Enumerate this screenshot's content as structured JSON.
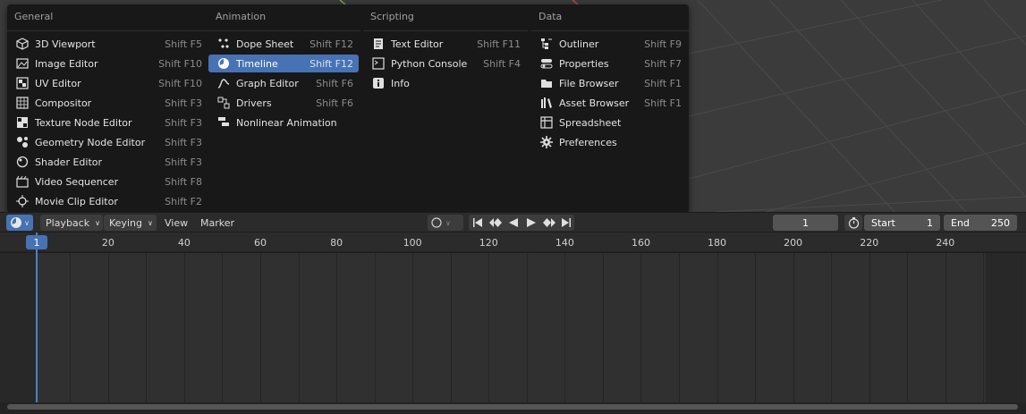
{
  "menu": {
    "columns": [
      {
        "header": "General",
        "items": [
          {
            "icon": "3d-viewport-icon",
            "label": "3D Viewport",
            "shortcut": "Shift F5"
          },
          {
            "icon": "image-editor-icon",
            "label": "Image Editor",
            "shortcut": "Shift F10"
          },
          {
            "icon": "uv-editor-icon",
            "label": "UV Editor",
            "shortcut": "Shift F10"
          },
          {
            "icon": "compositor-icon",
            "label": "Compositor",
            "shortcut": "Shift F3"
          },
          {
            "icon": "texture-node-editor-icon",
            "label": "Texture Node Editor",
            "shortcut": "Shift F3"
          },
          {
            "icon": "geometry-node-editor-icon",
            "label": "Geometry Node Editor",
            "shortcut": "Shift F3"
          },
          {
            "icon": "shader-editor-icon",
            "label": "Shader Editor",
            "shortcut": "Shift F3"
          },
          {
            "icon": "video-sequencer-icon",
            "label": "Video Sequencer",
            "shortcut": "Shift F8"
          },
          {
            "icon": "movie-clip-editor-icon",
            "label": "Movie Clip Editor",
            "shortcut": "Shift F2"
          }
        ]
      },
      {
        "header": "Animation",
        "items": [
          {
            "icon": "dope-sheet-icon",
            "label": "Dope Sheet",
            "shortcut": "Shift F12"
          },
          {
            "icon": "timeline-icon",
            "label": "Timeline",
            "shortcut": "Shift F12",
            "active": true
          },
          {
            "icon": "graph-editor-icon",
            "label": "Graph Editor",
            "shortcut": "Shift F6"
          },
          {
            "icon": "drivers-icon",
            "label": "Drivers",
            "shortcut": "Shift F6"
          },
          {
            "icon": "nonlinear-animation-icon",
            "label": "Nonlinear Animation",
            "shortcut": ""
          }
        ]
      },
      {
        "header": "Scripting",
        "items": [
          {
            "icon": "text-editor-icon",
            "label": "Text Editor",
            "shortcut": "Shift F11"
          },
          {
            "icon": "python-console-icon",
            "label": "Python Console",
            "shortcut": "Shift F4"
          },
          {
            "icon": "info-icon",
            "label": "Info",
            "shortcut": ""
          }
        ]
      },
      {
        "header": "Data",
        "items": [
          {
            "icon": "outliner-icon",
            "label": "Outliner",
            "shortcut": "Shift F9"
          },
          {
            "icon": "properties-icon",
            "label": "Properties",
            "shortcut": "Shift F7"
          },
          {
            "icon": "file-browser-icon",
            "label": "File Browser",
            "shortcut": "Shift F1"
          },
          {
            "icon": "asset-browser-icon",
            "label": "Asset Browser",
            "shortcut": "Shift F1"
          },
          {
            "icon": "spreadsheet-icon",
            "label": "Spreadsheet",
            "shortcut": ""
          },
          {
            "icon": "preferences-icon",
            "label": "Preferences",
            "shortcut": ""
          }
        ]
      }
    ]
  },
  "header": {
    "playback_label": "Playback",
    "keying_label": "Keying",
    "view_label": "View",
    "marker_label": "Marker",
    "current_frame": "1",
    "start_label": "Start",
    "start_value": "1",
    "end_label": "End",
    "end_value": "250"
  },
  "ruler": {
    "playhead_frame": "1",
    "ticks": [
      "20",
      "40",
      "60",
      "80",
      "100",
      "120",
      "140",
      "160",
      "180",
      "200",
      "220",
      "240"
    ]
  },
  "colors": {
    "accent": "#4772b3",
    "playhead": "#4d80c6"
  }
}
